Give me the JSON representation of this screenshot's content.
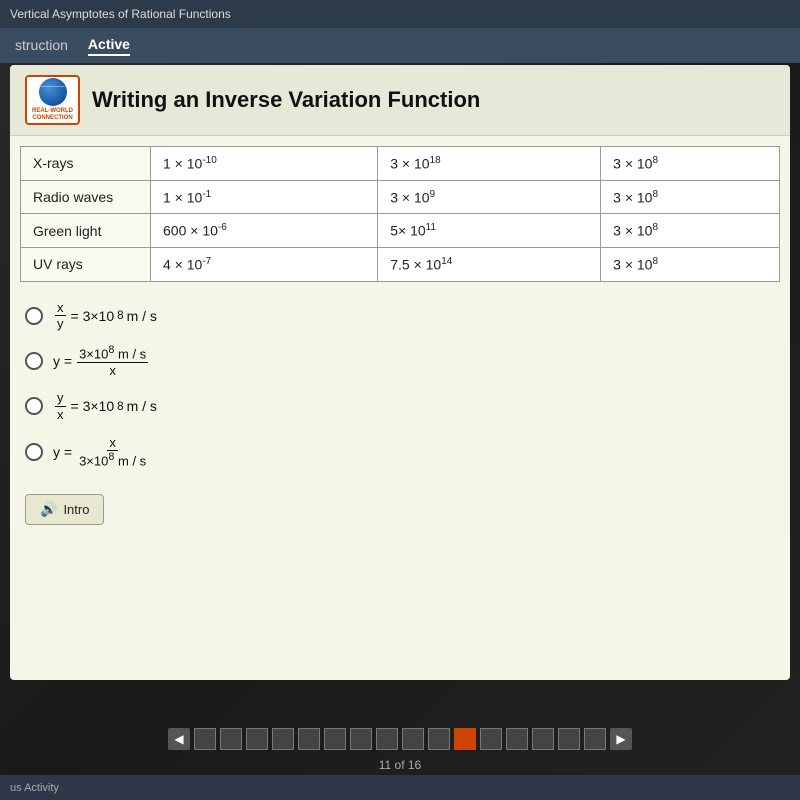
{
  "browser": {
    "url": "r22.core.learn.edgenuity.com",
    "page_title": "Vertical Asymptotes of Rational Functions"
  },
  "nav": {
    "tabs": [
      {
        "label": "struction",
        "active": false
      },
      {
        "label": "Active",
        "active": true
      }
    ]
  },
  "card": {
    "badge_line1": "REAL-WORLD",
    "badge_line2": "CONNECTION",
    "title": "Writing an Inverse Variation Function"
  },
  "table": {
    "rows": [
      {
        "name": "X-rays",
        "col2": "1 × 10⁻¹⁰",
        "col3": "3 × 10¹⁸",
        "col4": "3 × 10⁸"
      },
      {
        "name": "Radio waves",
        "col2": "1 × 10⁻¹",
        "col3": "3 × 10⁹",
        "col4": "3 × 10⁸"
      },
      {
        "name": "Green light",
        "col2": "600 × 10⁻⁶",
        "col3": "5× 10¹¹",
        "col4": "3 × 10⁸"
      },
      {
        "name": "UV rays",
        "col2": "4 × 10⁻⁷",
        "col3": "7.5 × 10¹⁴",
        "col4": "3 × 10⁸"
      }
    ]
  },
  "options": [
    {
      "id": "opt1",
      "formula_html": "x/y = 3×10⁸ m/s"
    },
    {
      "id": "opt2",
      "formula_html": "y = 3×10⁸ m/s / x"
    },
    {
      "id": "opt3",
      "formula_html": "y/x = 3×10⁸ m/s"
    },
    {
      "id": "opt4",
      "formula_html": "y = x / 3×10⁸ m/s"
    }
  ],
  "intro_button": {
    "label": "Intro"
  },
  "pagination": {
    "current": 11,
    "total": 16,
    "label": "11 of 16",
    "squares": [
      1,
      2,
      3,
      4,
      5,
      6,
      7,
      8,
      9,
      10,
      11,
      12,
      13,
      14,
      15,
      16
    ],
    "active_index": 10
  },
  "bottom": {
    "activity_label": "us Activity"
  }
}
